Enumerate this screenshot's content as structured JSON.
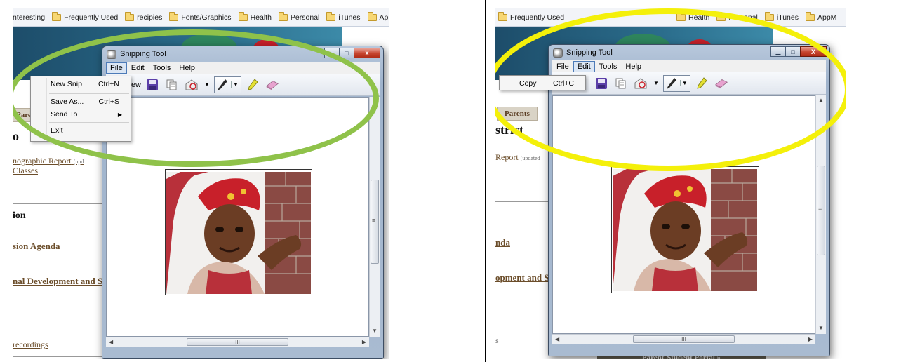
{
  "bookmarks": {
    "left": [
      "nteresting",
      "Frequently Used",
      "recipies",
      "Fonts/Graphics",
      "Health",
      "Personal",
      "iTunes",
      "Ap"
    ],
    "right": [
      "Frequently Used",
      "Health",
      "Personal",
      "iTunes",
      "AppM"
    ]
  },
  "background_page": {
    "left": {
      "tab": "Parents",
      "heading1": "o",
      "link_report": "nographic Report",
      "link_report_note": "(upd",
      "link_classes": "Classes",
      "heading2": "ion",
      "link_agenda": "sion Agenda",
      "link_development": "nal Development and S",
      "link_recordings": "recordings"
    },
    "right": {
      "tab": "Parents",
      "heading1": "strict",
      "link_report": "Report",
      "link_report_note": "(updated",
      "link_agenda": "nda",
      "link_development": "opment and S",
      "fragment": "s",
      "footer": "Parent-Student Portal »"
    }
  },
  "snipping_tool": {
    "title": "Snipping Tool",
    "menu": [
      "File",
      "Edit",
      "Tools",
      "Help"
    ],
    "toolbar_new_label": "New",
    "scroll_thumb_grip": "III",
    "scroll_vgrip": "≡",
    "controls": {
      "minimize": "▁",
      "maximize": "□",
      "close": "X"
    }
  },
  "file_menu": {
    "items": [
      {
        "label": "New Snip",
        "shortcut": "Ctrl+N"
      },
      {
        "label": "Save As...",
        "shortcut": "Ctrl+S"
      },
      {
        "label": "Send To",
        "shortcut": ""
      },
      {
        "label": "Exit",
        "shortcut": ""
      }
    ],
    "submenu_arrow": "▶"
  },
  "edit_menu": {
    "items": [
      {
        "label": "Copy",
        "shortcut": "Ctrl+C"
      }
    ]
  },
  "highlight_colors": {
    "left": "#8fc24a",
    "right": "#f4f00a"
  },
  "icons": [
    "folder-icon",
    "snipping-tool-icon",
    "save-icon",
    "copy-icon",
    "send-icon",
    "pen-icon",
    "highlighter-icon",
    "eraser-icon"
  ]
}
